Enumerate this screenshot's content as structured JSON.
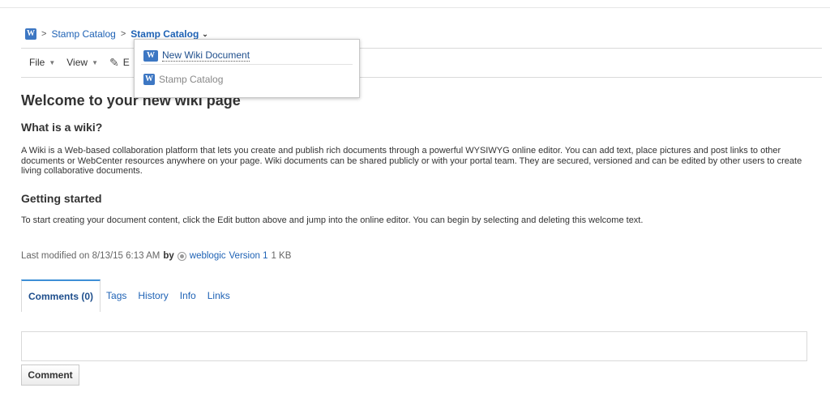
{
  "breadcrumb": {
    "app_icon": "W",
    "items": [
      "Stamp Catalog"
    ],
    "current": "Stamp Catalog"
  },
  "toolbar": {
    "file": "File",
    "view": "View",
    "edit_partial": "E"
  },
  "dropdown": {
    "new_item": "New Wiki Document",
    "existing_item": "Stamp Catalog"
  },
  "content": {
    "title": "Welcome to your new wiki page",
    "section1_heading": "What is a wiki?",
    "section1_text": "A Wiki is a Web-based collaboration platform that lets you create and publish rich documents through a powerful WYSIWYG online editor. You can add text, place pictures and post links to other documents or WebCenter resources anywhere on your page. Wiki documents can be shared publicly or with your portal team. They are secured, versioned and can be edited by other users to create living collaborative documents.",
    "section2_heading": "Getting started",
    "section2_text": "To start creating your document content, click the Edit button above and jump into the online editor. You can begin by selecting and deleting this welcome text."
  },
  "meta": {
    "last_modified": "Last modified on 8/13/15 6:13 AM",
    "by": "by",
    "user": "weblogic",
    "version": "Version 1",
    "size": "1 KB"
  },
  "tabs": [
    "Comments (0)",
    "Tags",
    "History",
    "Info",
    "Links"
  ],
  "comment": {
    "button_label": "Comment"
  },
  "colors": {
    "link": "#1e62b5",
    "accent": "#3d8fd6",
    "icon_bg": "#3d77c3"
  }
}
